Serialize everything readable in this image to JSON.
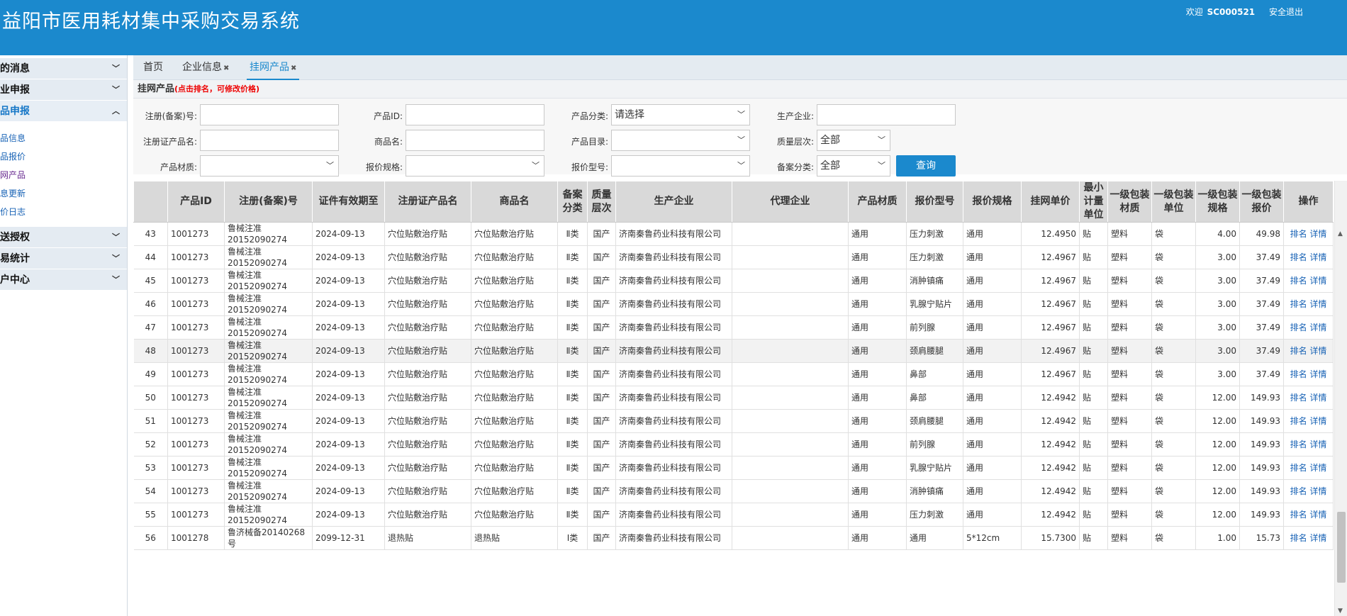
{
  "header": {
    "title": "益阳市医用耗材集中采购交易系统",
    "welcome": "欢迎",
    "user_id": "SC000521",
    "logout": "安全退出"
  },
  "sidebar": {
    "sections": [
      {
        "label": "的消息"
      },
      {
        "label": "业申报"
      },
      {
        "label": "品申报",
        "active": true
      }
    ],
    "sub_items": [
      "品信息",
      "品报价",
      "网产品",
      "息更新",
      "价日志"
    ],
    "more_sections": [
      {
        "label": "送授权"
      },
      {
        "label": "易统计"
      },
      {
        "label": "户中心"
      }
    ]
  },
  "tabs": [
    {
      "label": "首页",
      "closable": false
    },
    {
      "label": "企业信息",
      "closable": true
    },
    {
      "label": "挂网产品",
      "closable": true,
      "active": true
    }
  ],
  "panel": {
    "title": "挂网产品",
    "hint": "(点击排名，可修改价格)"
  },
  "filters": {
    "reg_no_label": "注册(备案)号:",
    "reg_no_value": "",
    "product_id_label": "产品ID:",
    "product_id_value": "",
    "category_label": "产品分类:",
    "category_value": "请选择",
    "maker_label": "生产企业:",
    "maker_value": "",
    "reg_name_label": "注册证产品名:",
    "reg_name_value": "",
    "trade_name_label": "商品名:",
    "trade_name_value": "",
    "catalog_label": "产品目录:",
    "catalog_value": "",
    "quality_label": "质量层次:",
    "quality_value": "全部",
    "material_label": "产品材质:",
    "material_value": "",
    "spec_label": "报价规格:",
    "spec_value": "",
    "model_label": "报价型号:",
    "model_value": "",
    "record_label": "备案分类:",
    "record_value": "全部",
    "query_button": "查询"
  },
  "table": {
    "headers": [
      "",
      "产品ID",
      "注册(备案)号",
      "证件有效期至",
      "注册证产品名",
      "商品名",
      "备案分类",
      "质量层次",
      "生产企业",
      "代理企业",
      "产品材质",
      "报价型号",
      "报价规格",
      "挂网单价",
      "最小计量单位",
      "一级包装材质",
      "一级包装单位",
      "一级包装规格",
      "一级包装报价",
      "操作"
    ],
    "op_rank": "排名",
    "op_detail": "详情",
    "rows": [
      {
        "no": "43",
        "pid": "1001273",
        "reg": "鲁械注准20152090274",
        "valid": "2024-09-13",
        "rname": "穴位贴敷治疗贴",
        "tname": "穴位贴敷治疗贴",
        "cls": "Ⅱ类",
        "quality": "国产",
        "maker": "济南秦鲁药业科技有限公司",
        "agent": "",
        "mat": "通用",
        "model": "压力刺激",
        "spec": "通用",
        "price": "12.4950",
        "unit": "贴",
        "pmat": "塑料",
        "punit": "袋",
        "pspec": "4.00",
        "pprice": "49.98"
      },
      {
        "no": "44",
        "pid": "1001273",
        "reg": "鲁械注准20152090274",
        "valid": "2024-09-13",
        "rname": "穴位贴敷治疗贴",
        "tname": "穴位贴敷治疗贴",
        "cls": "Ⅱ类",
        "quality": "国产",
        "maker": "济南秦鲁药业科技有限公司",
        "agent": "",
        "mat": "通用",
        "model": "压力刺激",
        "spec": "通用",
        "price": "12.4967",
        "unit": "贴",
        "pmat": "塑料",
        "punit": "袋",
        "pspec": "3.00",
        "pprice": "37.49"
      },
      {
        "no": "45",
        "pid": "1001273",
        "reg": "鲁械注准20152090274",
        "valid": "2024-09-13",
        "rname": "穴位贴敷治疗贴",
        "tname": "穴位贴敷治疗贴",
        "cls": "Ⅱ类",
        "quality": "国产",
        "maker": "济南秦鲁药业科技有限公司",
        "agent": "",
        "mat": "通用",
        "model": "消肿镇痛",
        "spec": "通用",
        "price": "12.4967",
        "unit": "贴",
        "pmat": "塑料",
        "punit": "袋",
        "pspec": "3.00",
        "pprice": "37.49"
      },
      {
        "no": "46",
        "pid": "1001273",
        "reg": "鲁械注准20152090274",
        "valid": "2024-09-13",
        "rname": "穴位贴敷治疗贴",
        "tname": "穴位贴敷治疗贴",
        "cls": "Ⅱ类",
        "quality": "国产",
        "maker": "济南秦鲁药业科技有限公司",
        "agent": "",
        "mat": "通用",
        "model": "乳腺宁贴片",
        "spec": "通用",
        "price": "12.4967",
        "unit": "贴",
        "pmat": "塑料",
        "punit": "袋",
        "pspec": "3.00",
        "pprice": "37.49"
      },
      {
        "no": "47",
        "pid": "1001273",
        "reg": "鲁械注准20152090274",
        "valid": "2024-09-13",
        "rname": "穴位贴敷治疗贴",
        "tname": "穴位贴敷治疗贴",
        "cls": "Ⅱ类",
        "quality": "国产",
        "maker": "济南秦鲁药业科技有限公司",
        "agent": "",
        "mat": "通用",
        "model": "前列腺",
        "spec": "通用",
        "price": "12.4967",
        "unit": "贴",
        "pmat": "塑料",
        "punit": "袋",
        "pspec": "3.00",
        "pprice": "37.49"
      },
      {
        "no": "48",
        "pid": "1001273",
        "reg": "鲁械注准20152090274",
        "valid": "2024-09-13",
        "rname": "穴位贴敷治疗贴",
        "tname": "穴位贴敷治疗贴",
        "cls": "Ⅱ类",
        "quality": "国产",
        "maker": "济南秦鲁药业科技有限公司",
        "agent": "",
        "mat": "通用",
        "model": "颈肩腰腿",
        "spec": "通用",
        "price": "12.4967",
        "unit": "贴",
        "pmat": "塑料",
        "punit": "袋",
        "pspec": "3.00",
        "pprice": "37.49"
      },
      {
        "no": "49",
        "pid": "1001273",
        "reg": "鲁械注准20152090274",
        "valid": "2024-09-13",
        "rname": "穴位贴敷治疗贴",
        "tname": "穴位贴敷治疗贴",
        "cls": "Ⅱ类",
        "quality": "国产",
        "maker": "济南秦鲁药业科技有限公司",
        "agent": "",
        "mat": "通用",
        "model": "鼻部",
        "spec": "通用",
        "price": "12.4967",
        "unit": "贴",
        "pmat": "塑料",
        "punit": "袋",
        "pspec": "3.00",
        "pprice": "37.49"
      },
      {
        "no": "50",
        "pid": "1001273",
        "reg": "鲁械注准20152090274",
        "valid": "2024-09-13",
        "rname": "穴位贴敷治疗贴",
        "tname": "穴位贴敷治疗贴",
        "cls": "Ⅱ类",
        "quality": "国产",
        "maker": "济南秦鲁药业科技有限公司",
        "agent": "",
        "mat": "通用",
        "model": "鼻部",
        "spec": "通用",
        "price": "12.4942",
        "unit": "贴",
        "pmat": "塑料",
        "punit": "袋",
        "pspec": "12.00",
        "pprice": "149.93"
      },
      {
        "no": "51",
        "pid": "1001273",
        "reg": "鲁械注准20152090274",
        "valid": "2024-09-13",
        "rname": "穴位贴敷治疗贴",
        "tname": "穴位贴敷治疗贴",
        "cls": "Ⅱ类",
        "quality": "国产",
        "maker": "济南秦鲁药业科技有限公司",
        "agent": "",
        "mat": "通用",
        "model": "颈肩腰腿",
        "spec": "通用",
        "price": "12.4942",
        "unit": "贴",
        "pmat": "塑料",
        "punit": "袋",
        "pspec": "12.00",
        "pprice": "149.93"
      },
      {
        "no": "52",
        "pid": "1001273",
        "reg": "鲁械注准20152090274",
        "valid": "2024-09-13",
        "rname": "穴位贴敷治疗贴",
        "tname": "穴位贴敷治疗贴",
        "cls": "Ⅱ类",
        "quality": "国产",
        "maker": "济南秦鲁药业科技有限公司",
        "agent": "",
        "mat": "通用",
        "model": "前列腺",
        "spec": "通用",
        "price": "12.4942",
        "unit": "贴",
        "pmat": "塑料",
        "punit": "袋",
        "pspec": "12.00",
        "pprice": "149.93"
      },
      {
        "no": "53",
        "pid": "1001273",
        "reg": "鲁械注准20152090274",
        "valid": "2024-09-13",
        "rname": "穴位贴敷治疗贴",
        "tname": "穴位贴敷治疗贴",
        "cls": "Ⅱ类",
        "quality": "国产",
        "maker": "济南秦鲁药业科技有限公司",
        "agent": "",
        "mat": "通用",
        "model": "乳腺宁贴片",
        "spec": "通用",
        "price": "12.4942",
        "unit": "贴",
        "pmat": "塑料",
        "punit": "袋",
        "pspec": "12.00",
        "pprice": "149.93"
      },
      {
        "no": "54",
        "pid": "1001273",
        "reg": "鲁械注准20152090274",
        "valid": "2024-09-13",
        "rname": "穴位贴敷治疗贴",
        "tname": "穴位贴敷治疗贴",
        "cls": "Ⅱ类",
        "quality": "国产",
        "maker": "济南秦鲁药业科技有限公司",
        "agent": "",
        "mat": "通用",
        "model": "消肿镇痛",
        "spec": "通用",
        "price": "12.4942",
        "unit": "贴",
        "pmat": "塑料",
        "punit": "袋",
        "pspec": "12.00",
        "pprice": "149.93"
      },
      {
        "no": "55",
        "pid": "1001273",
        "reg": "鲁械注准20152090274",
        "valid": "2024-09-13",
        "rname": "穴位贴敷治疗贴",
        "tname": "穴位贴敷治疗贴",
        "cls": "Ⅱ类",
        "quality": "国产",
        "maker": "济南秦鲁药业科技有限公司",
        "agent": "",
        "mat": "通用",
        "model": "压力刺激",
        "spec": "通用",
        "price": "12.4942",
        "unit": "贴",
        "pmat": "塑料",
        "punit": "袋",
        "pspec": "12.00",
        "pprice": "149.93"
      },
      {
        "no": "56",
        "pid": "1001278",
        "reg": "鲁济械备20140268号",
        "valid": "2099-12-31",
        "rname": "退热贴",
        "tname": "退热贴",
        "cls": "Ⅰ类",
        "quality": "国产",
        "maker": "济南秦鲁药业科技有限公司",
        "agent": "",
        "mat": "通用",
        "model": "通用",
        "spec": "5*12cm",
        "price": "15.7300",
        "unit": "贴",
        "pmat": "塑料",
        "punit": "袋",
        "pspec": "1.00",
        "pprice": "15.73"
      }
    ]
  }
}
